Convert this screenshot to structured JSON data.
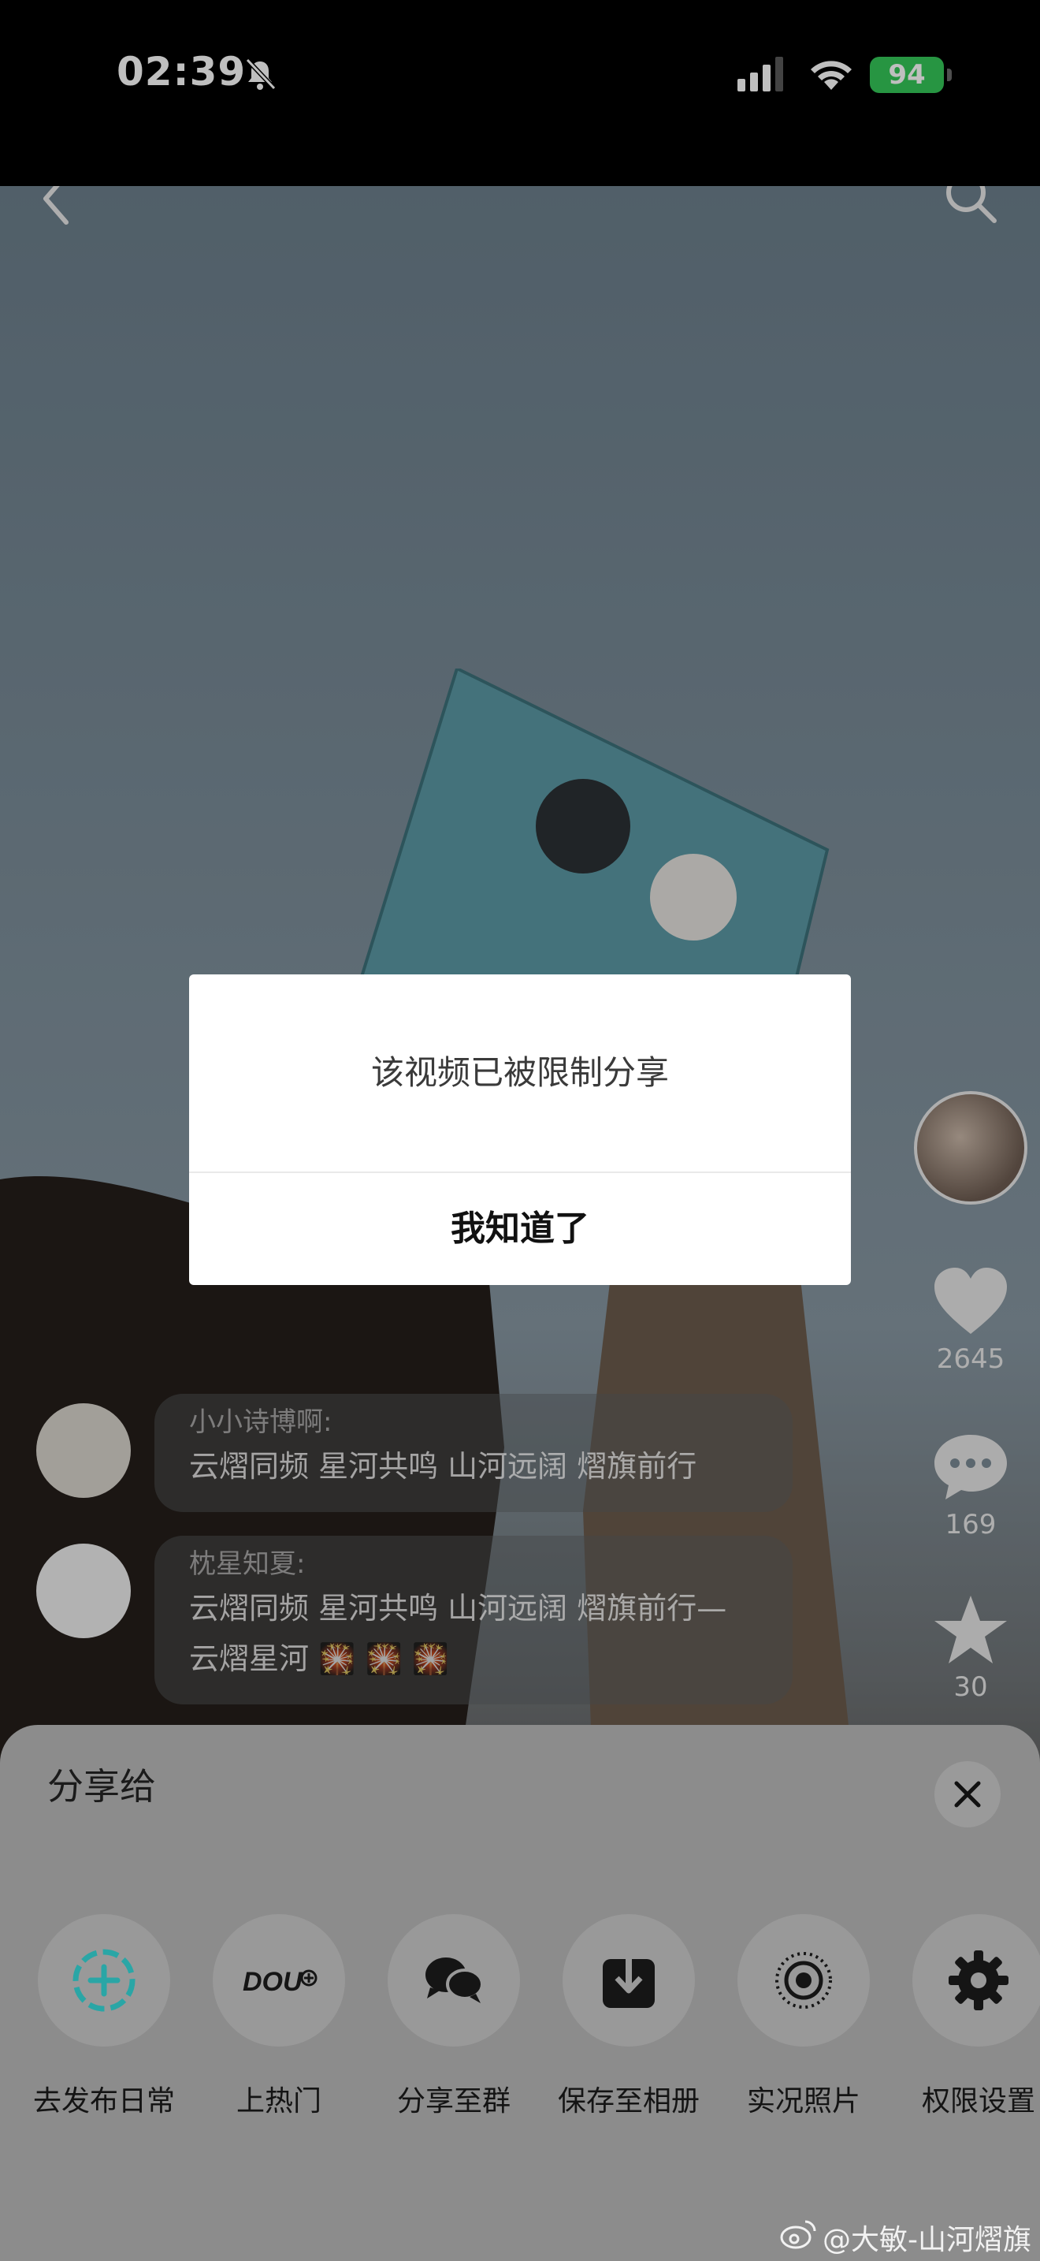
{
  "status_bar": {
    "time": "02:39",
    "battery": "94",
    "icons": [
      "bell-mute-icon",
      "signal-icon",
      "wifi-icon",
      "battery-charging-icon"
    ]
  },
  "video": {
    "header_icons": [
      "back-icon",
      "search-icon"
    ],
    "rail": {
      "like_count": "2645",
      "comment_count": "169",
      "favorite_count": "30"
    },
    "comments": [
      {
        "name": "小小诗博啊:",
        "text": "云熠同频  星河共鸣   山河远阔  熠旗前行"
      },
      {
        "name": "枕星知夏:",
        "text_line1": "云熠同频 星河共鸣 山河远阔 熠旗前行—",
        "text_line2": "云熠星河 🎇 🎇 🎇"
      }
    ]
  },
  "dialog": {
    "message": "该视频已被限制分享",
    "confirm_label": "我知道了"
  },
  "share_sheet": {
    "title": "分享给",
    "items": [
      {
        "label": "去发布日常",
        "icon": "publish-daily-icon"
      },
      {
        "label": "上热门",
        "icon": "dou-plus-icon"
      },
      {
        "label": "分享至群",
        "icon": "chat-group-icon"
      },
      {
        "label": "保存至相册",
        "icon": "download-icon"
      },
      {
        "label": "实况照片",
        "icon": "live-photo-icon"
      },
      {
        "label": "权限设置",
        "icon": "gear-icon"
      }
    ]
  },
  "watermark": "@大敏-山河熠旗",
  "colors": {
    "battery": "#34c759",
    "dialog_bg": "#ffffff",
    "sheet_bg": "#8c8c8c",
    "accent_teal": "#2aa6a6"
  }
}
